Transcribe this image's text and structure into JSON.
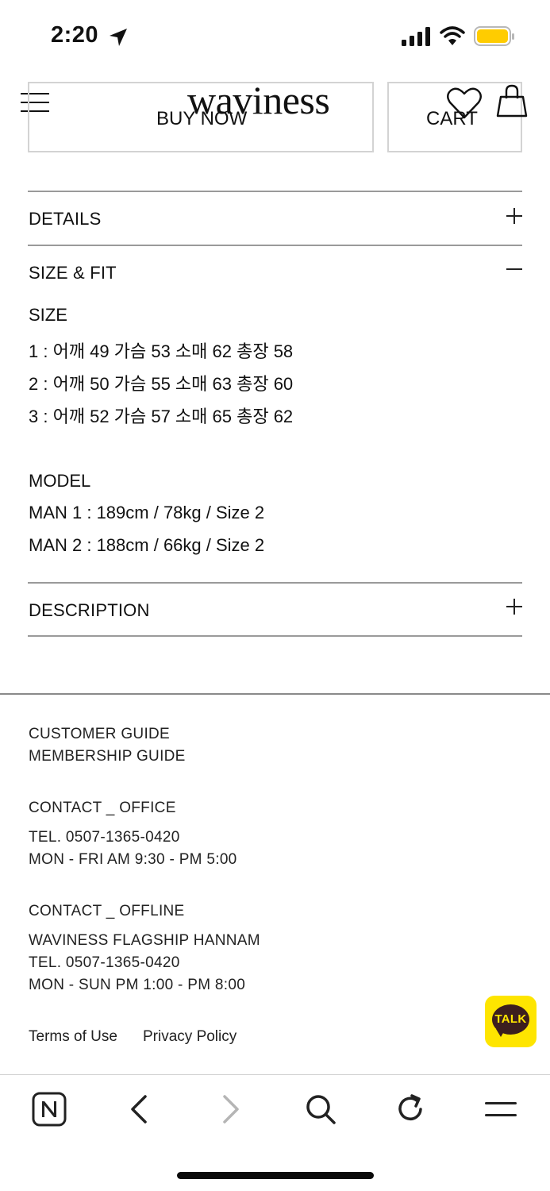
{
  "status_bar": {
    "time": "2:20"
  },
  "header": {
    "logo": "waviness",
    "buy_now_label": "BUY NOW",
    "cart_label": "CART"
  },
  "accordion": {
    "details_title": "DETAILS",
    "size_fit_title": "SIZE & FIT",
    "description_title": "DESCRIPTION"
  },
  "size_fit": {
    "size_heading": "SIZE",
    "sizes": [
      "1 : 어깨 49 가슴 53 소매 62 총장 58",
      "2 : 어깨 50 가슴 55 소매 63 총장 60",
      "3 : 어깨 52 가슴 57 소매 65 총장 62"
    ],
    "model_heading": "MODEL",
    "models": [
      "MAN 1 : 189cm / 78kg / Size 2",
      "MAN 2 : 188cm / 66kg / Size 2"
    ]
  },
  "footer": {
    "customer_guide": "CUSTOMER GUIDE",
    "membership_guide": "MEMBERSHIP GUIDE",
    "contact_office_heading": "CONTACT _ OFFICE",
    "office_tel": "TEL. 0507-1365-0420",
    "office_hours": "MON - FRI AM 9:30 - PM 5:00",
    "contact_offline_heading": "CONTACT _ OFFLINE",
    "offline_store": "WAVINESS FLAGSHIP HANNAM",
    "offline_tel": "TEL. 0507-1365-0420",
    "offline_hours": "MON - SUN PM 1:00 - PM 8:00",
    "terms_label": "Terms of Use",
    "privacy_label": "Privacy Policy"
  },
  "kakao": {
    "label": "TALK",
    "color": "#fee500"
  },
  "toolbar": {
    "icons": [
      "naver-home-icon",
      "back-icon",
      "forward-icon",
      "search-icon",
      "refresh-icon",
      "menu-icon"
    ]
  }
}
